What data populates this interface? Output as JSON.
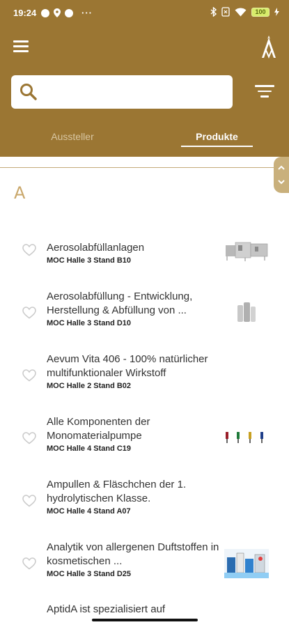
{
  "status": {
    "time": "19:24",
    "more": "···",
    "battery": "100"
  },
  "tabs": [
    {
      "label": "Aussteller"
    },
    {
      "label": "Produkte"
    }
  ],
  "search": {
    "placeholder": ""
  },
  "section": {
    "letter": "A"
  },
  "items": [
    {
      "title": "Aerosolabfüllanlagen",
      "location": "MOC Halle 3 Stand B10",
      "thumb": "filling-machine"
    },
    {
      "title": "Aerosolabfüllung - Entwicklung, Herstellung & Abfüllung von ...",
      "location": "MOC Halle 3 Stand D10",
      "thumb": "aerosol-cans"
    },
    {
      "title": "Aevum Vita 406 - 100% natürlicher multifunktionaler Wirkstoff",
      "location": "MOC Halle 2 Stand B02",
      "thumb": ""
    },
    {
      "title": "Alle Komponenten der Monomaterialpumpe",
      "location": "MOC Halle 4 Stand C19",
      "thumb": "pump-components"
    },
    {
      "title": "Ampullen & Fläschchen der 1. hydrolytischen Klasse.",
      "location": "MOC Halle 4 Stand A07",
      "thumb": ""
    },
    {
      "title": "Analytik von allergenen Duftstoffen in kosmetischen ...",
      "location": "MOC Halle 3 Stand D25",
      "thumb": "lab-analysis"
    }
  ],
  "partial_item": {
    "title": "AptidA ist spezialisiert auf"
  },
  "colors": {
    "header": "#9b7633",
    "accent": "#c9a76a"
  }
}
